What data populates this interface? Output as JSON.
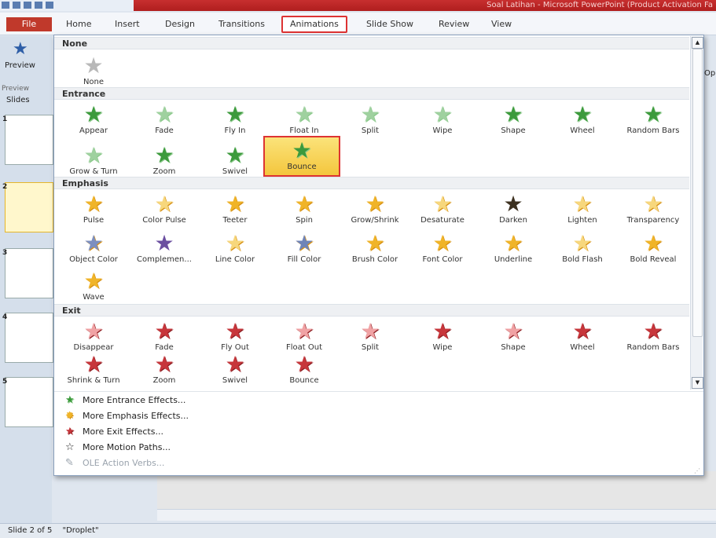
{
  "window": {
    "title": "Soal Latihan - Microsoft PowerPoint (Product Activation Fa"
  },
  "ribbon": {
    "file": "File",
    "tabs": [
      "Home",
      "Insert",
      "Design",
      "Transitions",
      "Animations",
      "Slide Show",
      "Review",
      "View"
    ],
    "active_tab": "Animations",
    "preview_label": "Preview",
    "preview_group": "Preview",
    "right_fragment": "Op"
  },
  "slides_pane": {
    "header": "Slides",
    "numbers": [
      "1",
      "2",
      "3",
      "4",
      "5"
    ]
  },
  "status": {
    "slide": "Slide 2 of 5",
    "theme": "\"Droplet\""
  },
  "gallery": {
    "sections": {
      "none": "None",
      "entrance": "Entrance",
      "emphasis": "Emphasis",
      "exit": "Exit"
    },
    "none_items": [
      "None"
    ],
    "entrance_items": [
      "Appear",
      "Fade",
      "Fly In",
      "Float In",
      "Split",
      "Wipe",
      "Shape",
      "Wheel",
      "Random Bars",
      "Grow & Turn",
      "Zoom",
      "Swivel",
      "Bounce"
    ],
    "emphasis_items": [
      "Pulse",
      "Color Pulse",
      "Teeter",
      "Spin",
      "Grow/Shrink",
      "Desaturate",
      "Darken",
      "Lighten",
      "Transparency",
      "Object Color",
      "Complemen...",
      "Line Color",
      "Fill Color",
      "Brush Color",
      "Font Color",
      "Underline",
      "Bold Flash",
      "Bold Reveal",
      "Wave"
    ],
    "exit_items": [
      "Disappear",
      "Fade",
      "Fly Out",
      "Float Out",
      "Split",
      "Wipe",
      "Shape",
      "Wheel",
      "Random Bars",
      "Shrink & Turn",
      "Zoom",
      "Swivel",
      "Bounce"
    ],
    "selected": "Bounce"
  },
  "menu": [
    "More Entrance Effects...",
    "More Emphasis Effects...",
    "More Exit Effects...",
    "More Motion Paths...",
    "OLE Action Verbs..."
  ],
  "colors": {
    "accent_red": "#d33333",
    "selection": "#f4c63d",
    "entrance": "#3c9a3c",
    "emphasis": "#f0b428",
    "exit": "#c7363b"
  }
}
